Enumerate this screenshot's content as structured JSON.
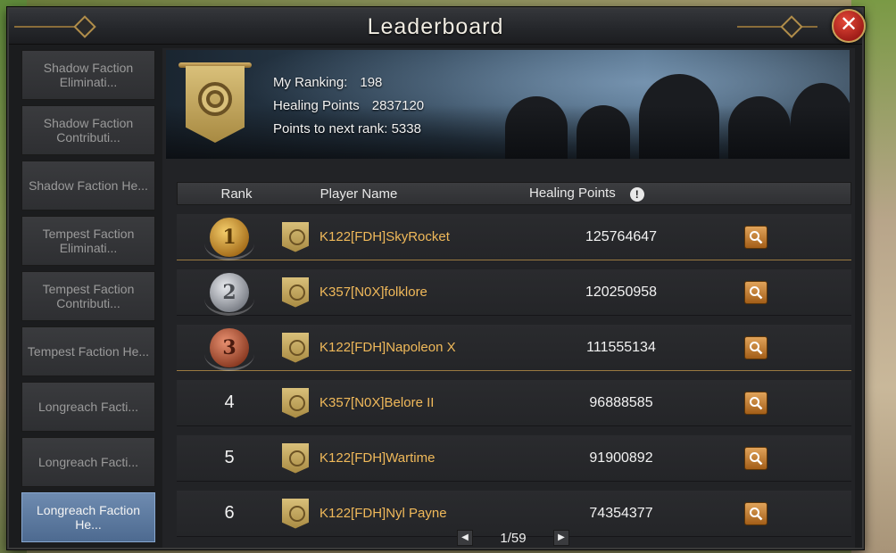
{
  "window": {
    "title": "Leaderboard"
  },
  "sidebar": {
    "items": [
      {
        "label": "Shadow Faction Eliminati...",
        "active": false
      },
      {
        "label": "Shadow Faction Contributi...",
        "active": false
      },
      {
        "label": "Shadow Faction He...",
        "active": false
      },
      {
        "label": "Tempest Faction Eliminati...",
        "active": false
      },
      {
        "label": "Tempest Faction Contributi...",
        "active": false
      },
      {
        "label": "Tempest Faction He...",
        "active": false
      },
      {
        "label": "Longreach Facti...",
        "active": false
      },
      {
        "label": "Longreach Facti...",
        "active": false
      },
      {
        "label": "Longreach Faction He...",
        "active": true
      }
    ]
  },
  "summary": {
    "ranking_label": "My Ranking:",
    "ranking_value": "198",
    "points_label": "Healing Points",
    "points_value": "2837120",
    "next_label": "Points to next rank:",
    "next_value": "5338"
  },
  "table": {
    "headers": {
      "rank": "Rank",
      "name": "Player Name",
      "points": "Healing Points",
      "info": "!"
    },
    "rows": [
      {
        "rank": "1",
        "name": "K122[FDH]SkyRocket",
        "points": "125764647",
        "medal": "gold"
      },
      {
        "rank": "2",
        "name": "K357[N0X]folklore",
        "points": "120250958",
        "medal": "silver"
      },
      {
        "rank": "3",
        "name": "K122[FDH]Napoleon X",
        "points": "111555134",
        "medal": "bronze"
      },
      {
        "rank": "4",
        "name": "K357[N0X]Belore II",
        "points": "96888585",
        "medal": ""
      },
      {
        "rank": "5",
        "name": "K122[FDH]Wartime",
        "points": "91900892",
        "medal": ""
      },
      {
        "rank": "6",
        "name": "K122[FDH]Nyl Payne",
        "points": "74354377",
        "medal": ""
      }
    ]
  },
  "pager": {
    "text": "1/59",
    "prev": "◀",
    "next": "▶"
  },
  "close": {
    "label": "✕"
  }
}
